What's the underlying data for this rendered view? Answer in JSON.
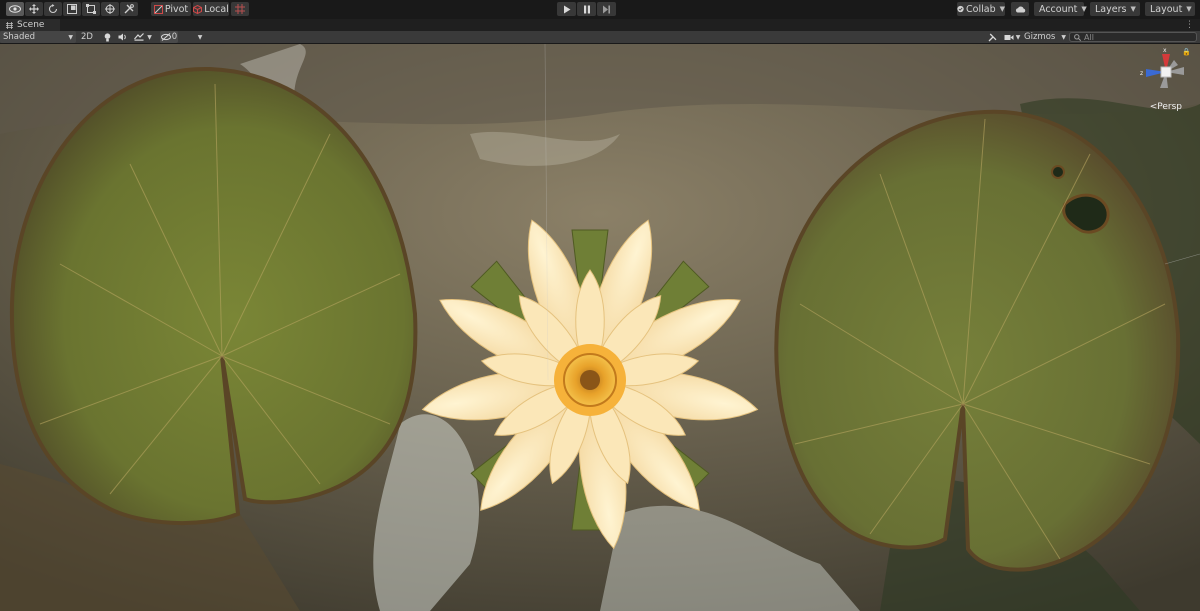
{
  "toolbar": {
    "tools": [
      {
        "name": "view-tool-icon",
        "active": true
      },
      {
        "name": "move-tool-icon",
        "active": false
      },
      {
        "name": "rotate-tool-icon",
        "active": false
      },
      {
        "name": "scale-tool-icon",
        "active": false
      },
      {
        "name": "rect-tool-icon",
        "active": false
      },
      {
        "name": "transform-tool-icon",
        "active": false
      },
      {
        "name": "custom-tool-icon",
        "active": false
      }
    ],
    "pivot_label": "Pivot",
    "local_label": "Local",
    "play_icon": "play-icon",
    "pause_icon": "pause-icon",
    "step_icon": "step-icon",
    "collab_label": "Collab",
    "cloud_icon": "cloud-icon",
    "account_label": "Account",
    "layers_label": "Layers",
    "layout_label": "Layout"
  },
  "scene_tab": {
    "label": "Scene"
  },
  "scene_toolbar": {
    "shading_mode": "Shaded",
    "mode_2d": "2D",
    "hidden_count": "0",
    "gizmos_label": "Gizmos",
    "search_placeholder": "All"
  },
  "viewport": {
    "gizmo_axes": {
      "x": "x",
      "y": "y",
      "z": "z"
    },
    "projection_label": "Persp"
  },
  "colors": {
    "toolbar_bg": "#191919",
    "button_bg": "#383838",
    "scene_bar_bg": "#3a3a3a",
    "axis_x": "#d43a3a",
    "axis_y": "#8ac84a",
    "axis_z": "#3a6ad4",
    "lily_pad": "#6f7d32",
    "petal": "#f6dfa8",
    "flower_center": "#e89a23"
  }
}
